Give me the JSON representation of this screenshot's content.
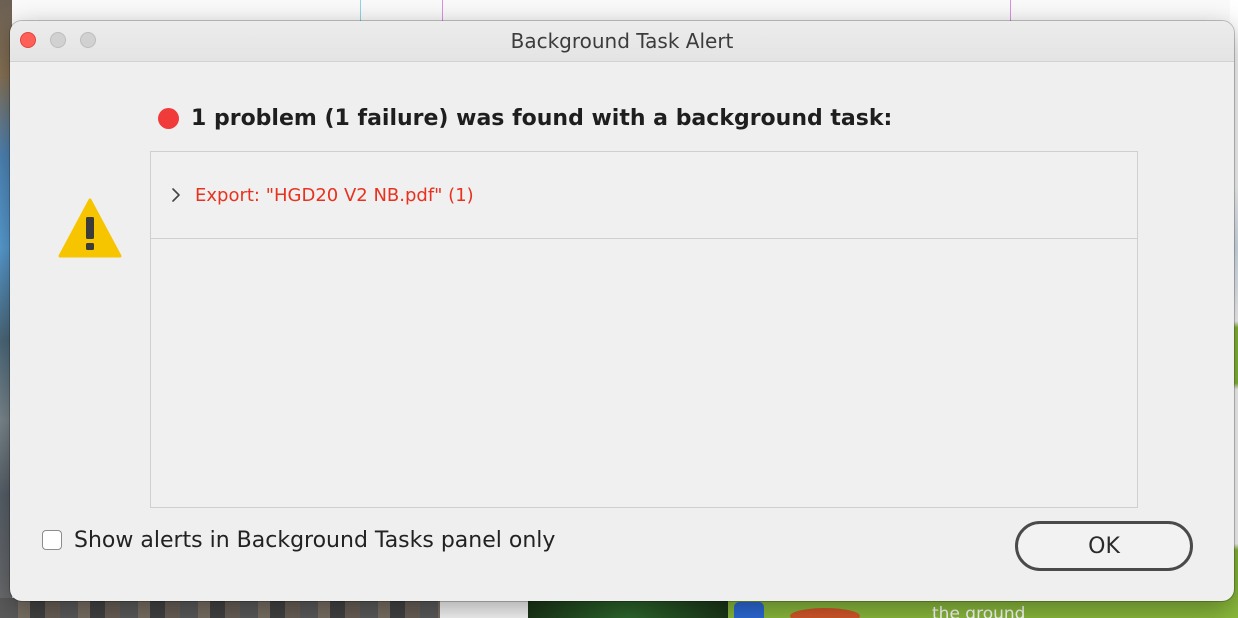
{
  "window": {
    "title": "Background Task Alert"
  },
  "alert": {
    "icon": "warning-triangle-icon",
    "status_icon": "red-dot-icon",
    "headline": "1 problem (1 failure) was found with a background task:",
    "problems": [
      {
        "label": "Export: \"HGD20 V2 NB.pdf\" (1)",
        "expanded": false
      }
    ]
  },
  "options": {
    "show_in_panel_only_label": "Show alerts in Background Tasks panel only",
    "show_in_panel_only_checked": false
  },
  "buttons": {
    "ok_label": "OK"
  },
  "background": {
    "partial_text": "the ground"
  },
  "colors": {
    "error_red": "#e8321f",
    "dot_red": "#f13a3a",
    "warning_yellow": "#f7c500",
    "close_red": "#fe5f57"
  }
}
